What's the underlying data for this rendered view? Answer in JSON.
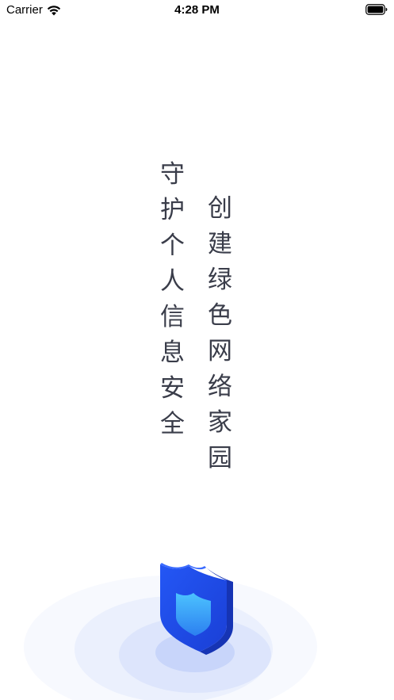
{
  "status_bar": {
    "carrier": "Carrier",
    "time": "4:28 PM",
    "icons": [
      "wifi-icon",
      "battery-icon"
    ]
  },
  "slogan": {
    "left_column": [
      "守",
      "护",
      "个",
      "人",
      "信",
      "息",
      "安",
      "全"
    ],
    "right_column": [
      "创",
      "建",
      "绿",
      "色",
      "网",
      "络",
      "家",
      "园"
    ]
  },
  "illustration": {
    "icon": "shield-icon",
    "colors": {
      "shield_primary": "#1f4ff0",
      "shield_side": "#173bc0",
      "shield_inner": "#3fa3f7",
      "ripple": "#d6e0fb"
    }
  }
}
